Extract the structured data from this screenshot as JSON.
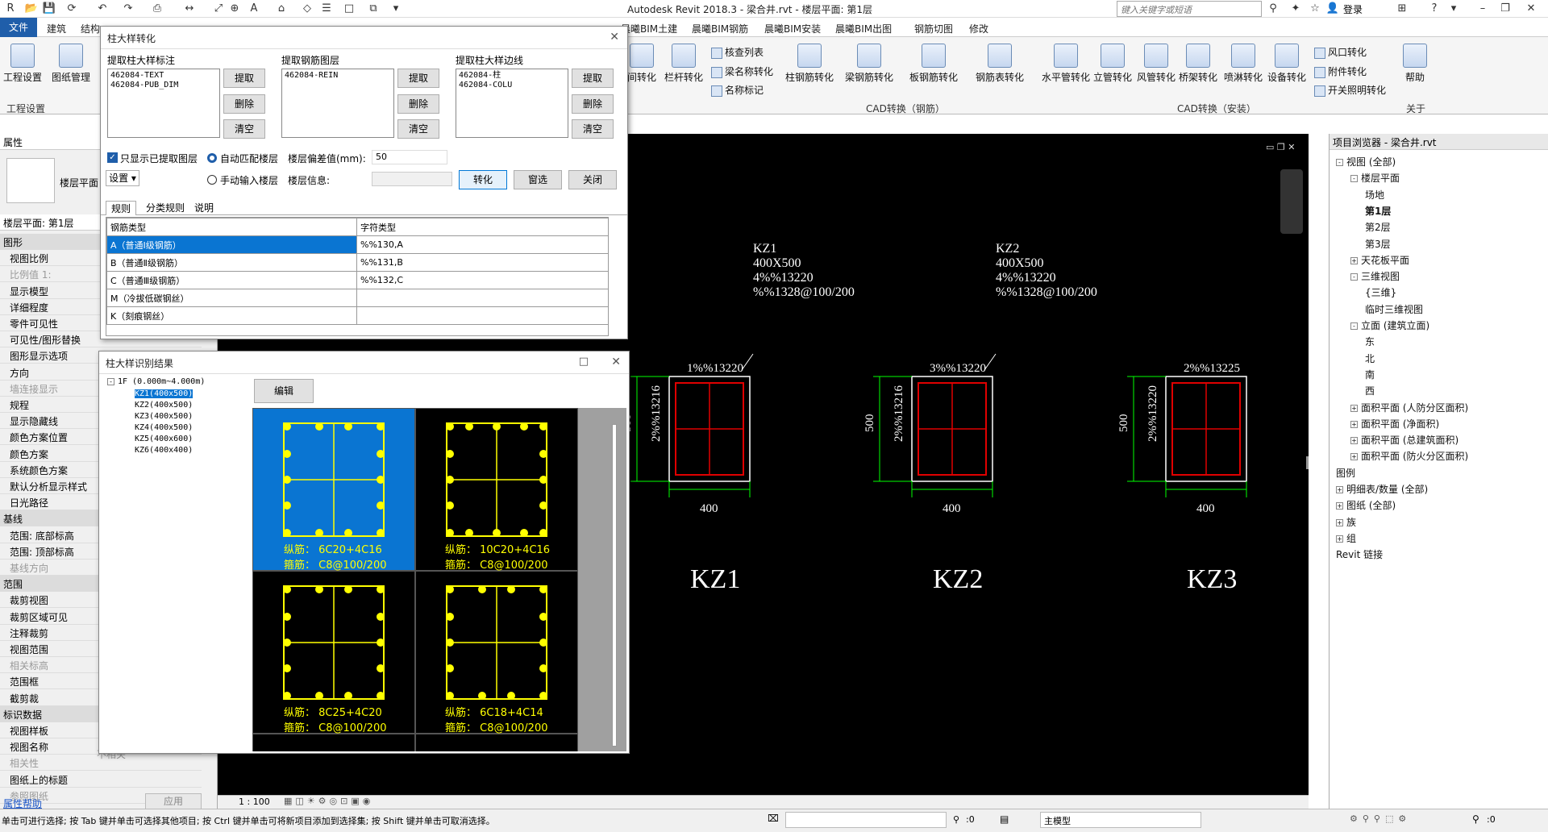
{
  "app": {
    "title": "Autodesk Revit 2018.3 -    梁合井.rvt - 楼层平面: 第1层",
    "search_placeholder": "键入关键字或短语",
    "login": "登录"
  },
  "ribbon_tabs": [
    "文件",
    "建筑",
    "结构",
    "晨曦BIM土建",
    "晨曦BIM钢筋",
    "晨曦BIM安装",
    "晨曦BIM出图",
    "钢筋切图",
    "修改"
  ],
  "ribbon": {
    "left_buttons": [
      "工程设置",
      "图纸管理"
    ],
    "left_group": "工程设置",
    "partial_buttons": [
      "间转化",
      "栏杆转化"
    ],
    "small_items_1": [
      "核查列表",
      "梁名称转化",
      "名称标记"
    ],
    "rebar_buttons": [
      "柱钢筋转化",
      "梁钢筋转化",
      "板钢筋转化",
      "钢筋表转化"
    ],
    "rebar_group": "CAD转换（钢筋）",
    "install_buttons": [
      "水平管转化",
      "立管转化",
      "风管转化",
      "桥架转化",
      "喷淋转化",
      "设备转化"
    ],
    "small_items_2": [
      "风口转化",
      "附件转化",
      "开关照明转化"
    ],
    "install_group": "CAD转换（安装）",
    "help_button": "帮助",
    "help_group": "关于"
  },
  "properties": {
    "title": "属性",
    "type_name": "楼层平面",
    "view_label": "楼层平面: 第1层",
    "rows": [
      {
        "label": "图形",
        "kind": "sec"
      },
      {
        "label": "视图比例",
        "kind": "row"
      },
      {
        "label": "比例值 1:",
        "kind": "dim"
      },
      {
        "label": "显示模型",
        "kind": "row"
      },
      {
        "label": "详细程度",
        "kind": "row"
      },
      {
        "label": "零件可见性",
        "kind": "row"
      },
      {
        "label": "可见性/图形替换",
        "kind": "row"
      },
      {
        "label": "图形显示选项",
        "kind": "row"
      },
      {
        "label": "方向",
        "kind": "row"
      },
      {
        "label": "墙连接显示",
        "kind": "dim"
      },
      {
        "label": "规程",
        "kind": "row"
      },
      {
        "label": "显示隐藏线",
        "kind": "row"
      },
      {
        "label": "颜色方案位置",
        "kind": "row"
      },
      {
        "label": "颜色方案",
        "kind": "row"
      },
      {
        "label": "系统颜色方案",
        "kind": "row"
      },
      {
        "label": "默认分析显示样式",
        "kind": "row"
      },
      {
        "label": "日光路径",
        "kind": "row"
      },
      {
        "label": "基线",
        "kind": "sec"
      },
      {
        "label": "范围: 底部标高",
        "kind": "row"
      },
      {
        "label": "范围: 顶部标高",
        "kind": "row"
      },
      {
        "label": "基线方向",
        "kind": "dim"
      },
      {
        "label": "范围",
        "kind": "sec"
      },
      {
        "label": "裁剪视图",
        "kind": "row"
      },
      {
        "label": "裁剪区域可见",
        "kind": "row"
      },
      {
        "label": "注释裁剪",
        "kind": "row"
      },
      {
        "label": "视图范围",
        "kind": "row"
      },
      {
        "label": "相关标高",
        "kind": "dim"
      },
      {
        "label": "范围框",
        "kind": "row"
      },
      {
        "label": "截剪裁",
        "kind": "row"
      },
      {
        "label": "标识数据",
        "kind": "sec"
      },
      {
        "label": "视图样板",
        "kind": "row"
      },
      {
        "label": "视图名称",
        "kind": "row"
      },
      {
        "label": "相关性",
        "kind": "dim"
      },
      {
        "label": "图纸上的标题",
        "kind": "row"
      },
      {
        "label": "参照图纸",
        "kind": "dim"
      }
    ],
    "relevance_value": "不相关",
    "apply": "应用",
    "help_link": "属性帮助"
  },
  "dialog1": {
    "title": "柱大样转化",
    "col1_label": "提取柱大样标注",
    "col1_items": "462084-TEXT\n462084-PUB_DIM",
    "col2_label": "提取钢筋图层",
    "col2_items": "462084-REIN",
    "col3_label": "提取柱大样边线",
    "col3_items": "462084-柱\n462084-COLU",
    "btn_extract": "提取",
    "btn_delete": "删除",
    "btn_clear": "清空",
    "chk_only_extracted": "只显示已提取图层",
    "radio_auto": "自动匹配楼层",
    "radio_manual": "手动输入楼层",
    "floor_tol_label": "楼层偏差值(mm):",
    "floor_tol_value": "50",
    "floor_info_label": "楼层信息:",
    "settings": "设置 ▾",
    "btn_convert": "转化",
    "btn_window": "窗选",
    "btn_close": "关闭",
    "tabs": [
      "规则",
      "分类规则",
      "说明"
    ],
    "grid_headers": [
      "钢筋类型",
      "字符类型"
    ],
    "grid_rows": [
      [
        "A（普通Ⅰ级钢筋）",
        "%%130,A"
      ],
      [
        "B（普通Ⅱ级钢筋）",
        "%%131,B"
      ],
      [
        "C（普通Ⅲ级钢筋）",
        "%%132,C"
      ],
      [
        "M（冷拔低碳钢丝）",
        ""
      ],
      [
        "K（刻痕钢丝）",
        ""
      ]
    ]
  },
  "dialog2": {
    "title": "柱大样识别结果",
    "tree_root": "1F (0.000m~4.000m)",
    "tree_items": [
      "KZ1(400x500)",
      "KZ2(400x500)",
      "KZ3(400x500)",
      "KZ4(400x500)",
      "KZ5(400x600)",
      "KZ6(400x400)"
    ],
    "edit_btn": "编辑",
    "cells": [
      {
        "long": "纵筋： 6C20+4C16",
        "stir": "箍筋： C8@100/200"
      },
      {
        "long": "纵筋： 10C20+4C16",
        "stir": "箍筋： C8@100/200"
      },
      {
        "long": "纵筋： 8C25+4C20",
        "stir": "箍筋： C8@100/200"
      },
      {
        "long": "纵筋： 6C18+4C14",
        "stir": "箍筋： C8@100/200"
      }
    ]
  },
  "drawing": {
    "columns": [
      {
        "name": "KZ1",
        "tag": "KZ1",
        "size": "400X500",
        "main": "4%%13220",
        "stir": "%%1328@100/200",
        "top": "1%%13220",
        "side": "2%%13216",
        "dim_w": "400",
        "dim_h": "500"
      },
      {
        "name": "KZ2",
        "tag": "KZ2",
        "size": "400X500",
        "main": "4%%13220",
        "stir": "%%1328@100/200",
        "top": "3%%13220",
        "side": "2%%13216",
        "dim_w": "400",
        "dim_h": "500"
      },
      {
        "name": "KZ3",
        "tag": "",
        "size": "",
        "main": "",
        "stir": "",
        "top": "2%%13225",
        "side": "2%%13220",
        "dim_w": "400",
        "dim_h": "500"
      }
    ]
  },
  "browser": {
    "title": "项目浏览器 - 梁合井.rvt",
    "items": [
      {
        "label": "视图 (全部)",
        "lvl": 0,
        "exp": "-"
      },
      {
        "label": "楼层平面",
        "lvl": 1,
        "exp": "-"
      },
      {
        "label": "场地",
        "lvl": 2,
        "exp": ""
      },
      {
        "label": "第1层",
        "lvl": 2,
        "exp": "",
        "bold": true
      },
      {
        "label": "第2层",
        "lvl": 2,
        "exp": ""
      },
      {
        "label": "第3层",
        "lvl": 2,
        "exp": ""
      },
      {
        "label": "天花板平面",
        "lvl": 1,
        "exp": "+"
      },
      {
        "label": "三维视图",
        "lvl": 1,
        "exp": "-"
      },
      {
        "label": "{三维}",
        "lvl": 2,
        "exp": ""
      },
      {
        "label": "临时三维视图",
        "lvl": 2,
        "exp": ""
      },
      {
        "label": "立面 (建筑立面)",
        "lvl": 1,
        "exp": "-"
      },
      {
        "label": "东",
        "lvl": 2,
        "exp": ""
      },
      {
        "label": "北",
        "lvl": 2,
        "exp": ""
      },
      {
        "label": "南",
        "lvl": 2,
        "exp": ""
      },
      {
        "label": "西",
        "lvl": 2,
        "exp": ""
      },
      {
        "label": "面积平面 (人防分区面积)",
        "lvl": 1,
        "exp": "+"
      },
      {
        "label": "面积平面 (净面积)",
        "lvl": 1,
        "exp": "+"
      },
      {
        "label": "面积平面 (总建筑面积)",
        "lvl": 1,
        "exp": "+"
      },
      {
        "label": "面积平面 (防火分区面积)",
        "lvl": 1,
        "exp": "+"
      },
      {
        "label": "图例",
        "lvl": 0,
        "exp": ""
      },
      {
        "label": "明细表/数量 (全部)",
        "lvl": 0,
        "exp": "+"
      },
      {
        "label": "图纸 (全部)",
        "lvl": 0,
        "exp": "+"
      },
      {
        "label": "族",
        "lvl": 0,
        "exp": "+"
      },
      {
        "label": "组",
        "lvl": 0,
        "exp": "+"
      },
      {
        "label": "Revit 链接",
        "lvl": 0,
        "exp": ""
      }
    ]
  },
  "view_bar": {
    "scale": "1 : 100"
  },
  "status": {
    "message": "单击可进行选择; 按 Tab 键并单击可选择其他项目; 按 Ctrl 键并单击可将新项目添加到选择集; 按 Shift 键并单击可取消选择。",
    "count1": ":0",
    "model": "主模型",
    "count2": ":0"
  }
}
